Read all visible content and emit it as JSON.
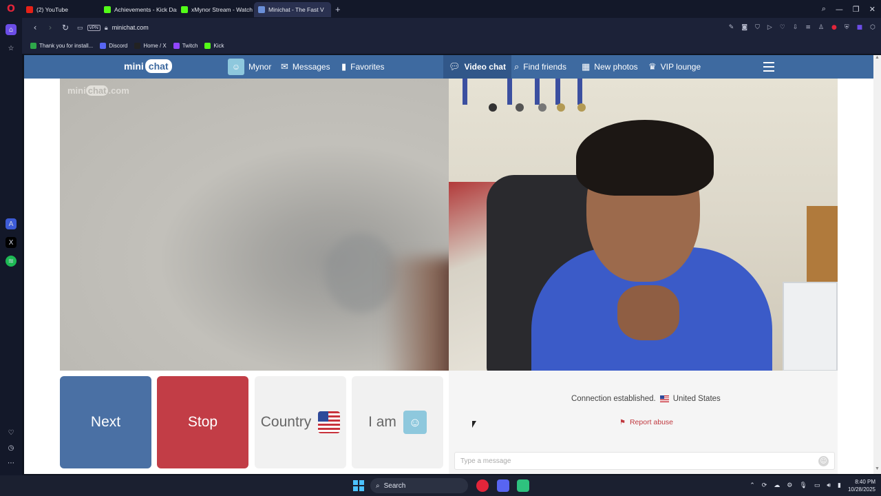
{
  "browser": {
    "tabs": [
      {
        "label": "(2) YouTube",
        "color": "#e62117"
      },
      {
        "label": "Achievements - Kick Dash",
        "color": "#53fc18"
      },
      {
        "label": "xMynor Stream - Watch Li",
        "color": "#53fc18"
      },
      {
        "label": "Minichat - The Fast V",
        "color": "#6a8fd8",
        "active": true
      }
    ],
    "address": "minichat.com",
    "vpn_label": "VPN",
    "bookmarks": [
      {
        "label": "Thank you for install...",
        "color": "#2ea84a"
      },
      {
        "label": "Discord",
        "color": "#5865f2"
      },
      {
        "label": "Home / X",
        "color": "#222222"
      },
      {
        "label": "Twitch",
        "color": "#9146ff"
      },
      {
        "label": "Kick",
        "color": "#53fc18"
      }
    ]
  },
  "site": {
    "logo_mini": "mini",
    "logo_chat": "chat",
    "nav": {
      "profile": "Mynor",
      "messages": "Messages",
      "favorites": "Favorites",
      "video_chat": "Video chat",
      "find_friends": "Find friends",
      "new_photos": "New photos",
      "vip_lounge": "VIP lounge"
    },
    "watermark_mini": "mini",
    "watermark_chat": "chat",
    "watermark_suffix": ".com"
  },
  "controls": {
    "next": "Next",
    "stop": "Stop",
    "country": "Country",
    "iam": "I am"
  },
  "info": {
    "status": "Connection established.",
    "country": "United States",
    "report": "Report abuse",
    "message_placeholder": "Type a message"
  },
  "taskbar": {
    "search": "Search",
    "time": "8:40 PM",
    "date": "10/28/2025"
  },
  "colors": {
    "header": "#3e6aa0",
    "next": "#4a70a4",
    "stop": "#c23d46"
  }
}
